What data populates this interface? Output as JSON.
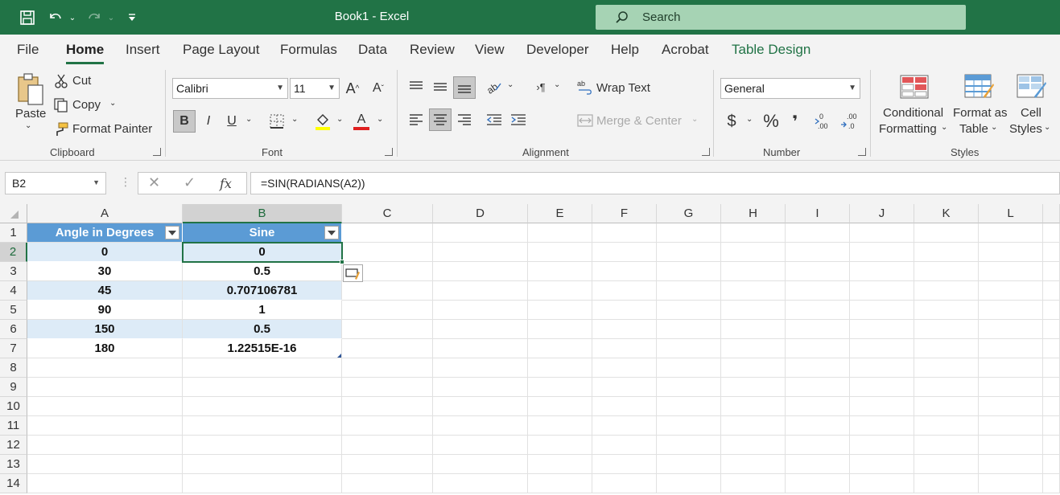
{
  "window": {
    "title": "Book1  -  Excel"
  },
  "search": {
    "label": "Search"
  },
  "tabs": [
    {
      "label": "File"
    },
    {
      "label": "Home"
    },
    {
      "label": "Insert"
    },
    {
      "label": "Page Layout"
    },
    {
      "label": "Formulas"
    },
    {
      "label": "Data"
    },
    {
      "label": "Review"
    },
    {
      "label": "View"
    },
    {
      "label": "Developer"
    },
    {
      "label": "Help"
    },
    {
      "label": "Acrobat"
    },
    {
      "label": "Table Design"
    }
  ],
  "active_tab": "Home",
  "ribbon": {
    "clipboard": {
      "paste": "Paste",
      "cut": "Cut",
      "copy": "Copy",
      "format_painter": "Format Painter",
      "label": "Clipboard"
    },
    "font": {
      "family": "Calibri",
      "size": "11",
      "bold": "B",
      "italic": "I",
      "underline": "U",
      "label": "Font"
    },
    "alignment": {
      "wrap_text": "Wrap Text",
      "merge_center": "Merge & Center",
      "label": "Alignment"
    },
    "number": {
      "format": "General",
      "currency": "$",
      "percent": "%",
      "comma": "❜",
      "label": "Number"
    },
    "styles": {
      "conditional_1": "Conditional",
      "conditional_2": "Formatting",
      "format_table_1": "Format as",
      "format_table_2": "Table",
      "cell_styles_1": "Cell",
      "cell_styles_2": "Styles",
      "label": "Styles"
    }
  },
  "formula_bar": {
    "name_box": "B2",
    "fx": "fx",
    "formula": "=SIN(RADIANS(A2))"
  },
  "columns": [
    "A",
    "B",
    "C",
    "D",
    "E",
    "F",
    "G",
    "H",
    "I",
    "J",
    "K",
    "L"
  ],
  "rows": [
    "1",
    "2",
    "3",
    "4",
    "5",
    "6",
    "7",
    "8",
    "9",
    "10",
    "11",
    "12",
    "13",
    "14"
  ],
  "table": {
    "headers": [
      "Angle in Degrees",
      "Sine"
    ],
    "rows": [
      [
        "0",
        "0"
      ],
      [
        "30",
        "0.5"
      ],
      [
        "45",
        "0.707106781"
      ],
      [
        "90",
        "1"
      ],
      [
        "150",
        "0.5"
      ],
      [
        "180",
        "1.22515E-16"
      ]
    ]
  },
  "selected_cell": "B2",
  "colors": {
    "excel_green": "#217346",
    "table_header": "#5b9bd5",
    "table_band": "#ddebf7"
  }
}
